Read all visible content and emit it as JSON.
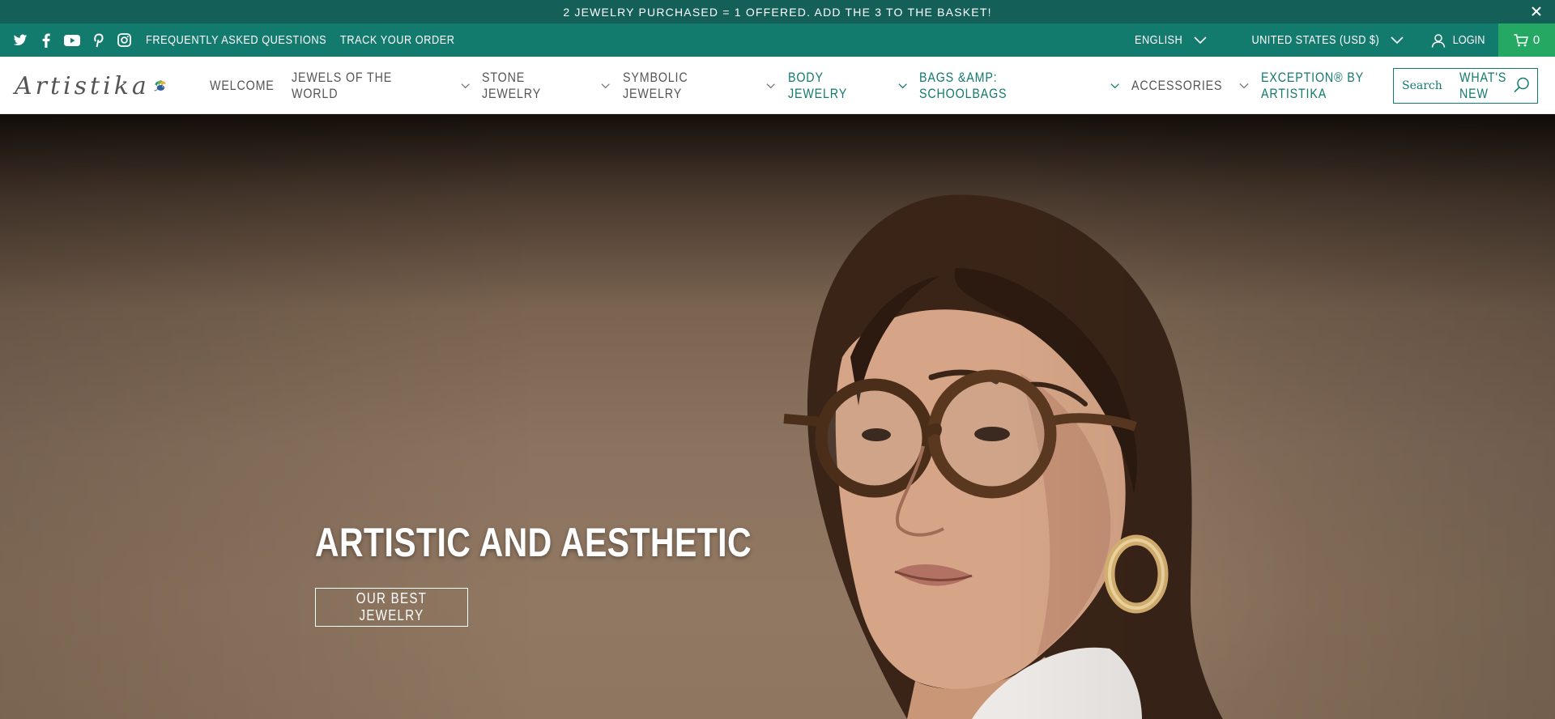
{
  "announcement": {
    "text": "2 JEWELRY PURCHASED = 1 OFFERED. ADD THE 3 TO THE BASKET!",
    "close_icon": "close-icon"
  },
  "topbar": {
    "social_icons": [
      "twitter-icon",
      "facebook-icon",
      "youtube-icon",
      "pinterest-icon",
      "instagram-icon"
    ],
    "links": [
      "FREQUENTLY ASKED QUESTIONS",
      "TRACK YOUR ORDER"
    ],
    "language": "ENGLISH",
    "currency": "UNITED STATES (USD $)",
    "login": "LOGIN",
    "cart_count": "0"
  },
  "header": {
    "logo_text": "Artistika",
    "nav": [
      {
        "label": "WELCOME",
        "dropdown": false,
        "accent": false
      },
      {
        "label": "JEWELS OF THE WORLD",
        "dropdown": true,
        "accent": false
      },
      {
        "label": "STONE JEWELRY",
        "dropdown": true,
        "accent": false
      },
      {
        "label": "SYMBOLIC JEWELRY",
        "dropdown": true,
        "accent": false
      },
      {
        "label": "BODY JEWELRY",
        "dropdown": true,
        "accent": true
      },
      {
        "label": "BAGS &AMP: SCHOOLBAGS",
        "dropdown": true,
        "accent": true
      },
      {
        "label": "ACCESSORIES",
        "dropdown": true,
        "accent": false
      },
      {
        "label": "EXCEPTION® BY ARTISTIKA",
        "dropdown": false,
        "accent": true
      },
      {
        "label": "WHAT'S NEW",
        "dropdown": false,
        "accent": true
      }
    ],
    "search_placeholder": "Search"
  },
  "hero": {
    "title": "ARTISTIC AND AESTHETIC",
    "button": "OUR BEST JEWELRY"
  },
  "colors": {
    "announcement_bg": "#145f58",
    "topbar_bg": "#137a6e",
    "cart_bg": "#24a862",
    "accent": "#137a6e"
  }
}
